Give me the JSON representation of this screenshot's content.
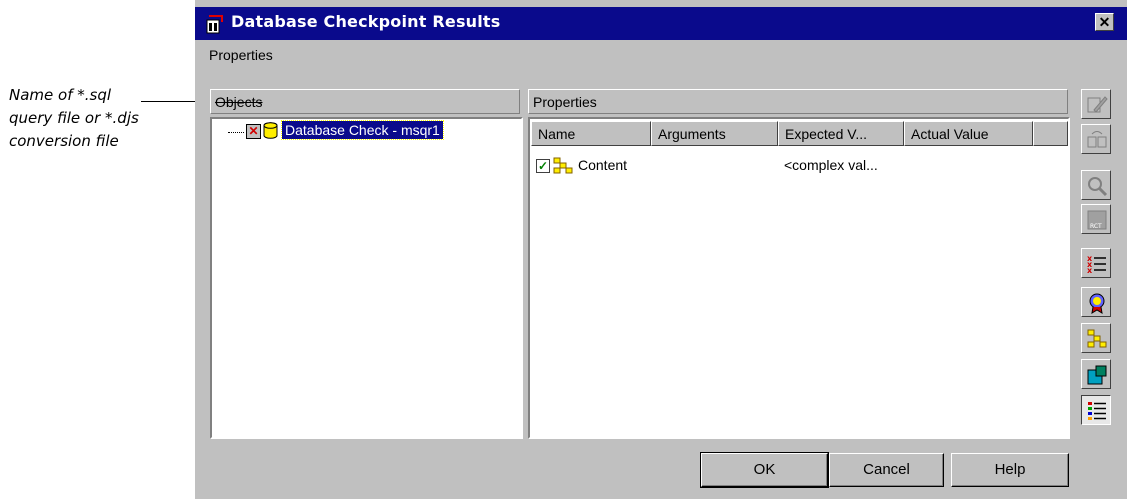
{
  "callout": {
    "line1": "Name of *.sql",
    "line2": "query file or *.djs",
    "line3": "conversion file"
  },
  "window": {
    "title": "Database Checkpoint Results",
    "close": "✕"
  },
  "menu": {
    "properties": "Properties"
  },
  "objects": {
    "header": "Objects",
    "tree_item": "Database Check - msqr1"
  },
  "properties": {
    "header": "Properties",
    "columns": [
      "Name",
      "Arguments",
      "Expected V...",
      "Actual Value"
    ],
    "rows": [
      {
        "name": "Content",
        "expected": "<complex val..."
      }
    ]
  },
  "toolbar": {
    "icons": [
      "edit-icon",
      "compare-icon",
      "zoom-icon",
      "rct-icon",
      "toggle-checks-icon",
      "verify-icon",
      "content-icon",
      "database-icon",
      "list-icon"
    ]
  },
  "buttons": {
    "ok": "OK",
    "cancel": "Cancel",
    "help": "Help"
  },
  "colors": {
    "titlebar": "#0a0a8c",
    "dialog": "#c0c0c0",
    "selection": "#0a0a8c"
  }
}
